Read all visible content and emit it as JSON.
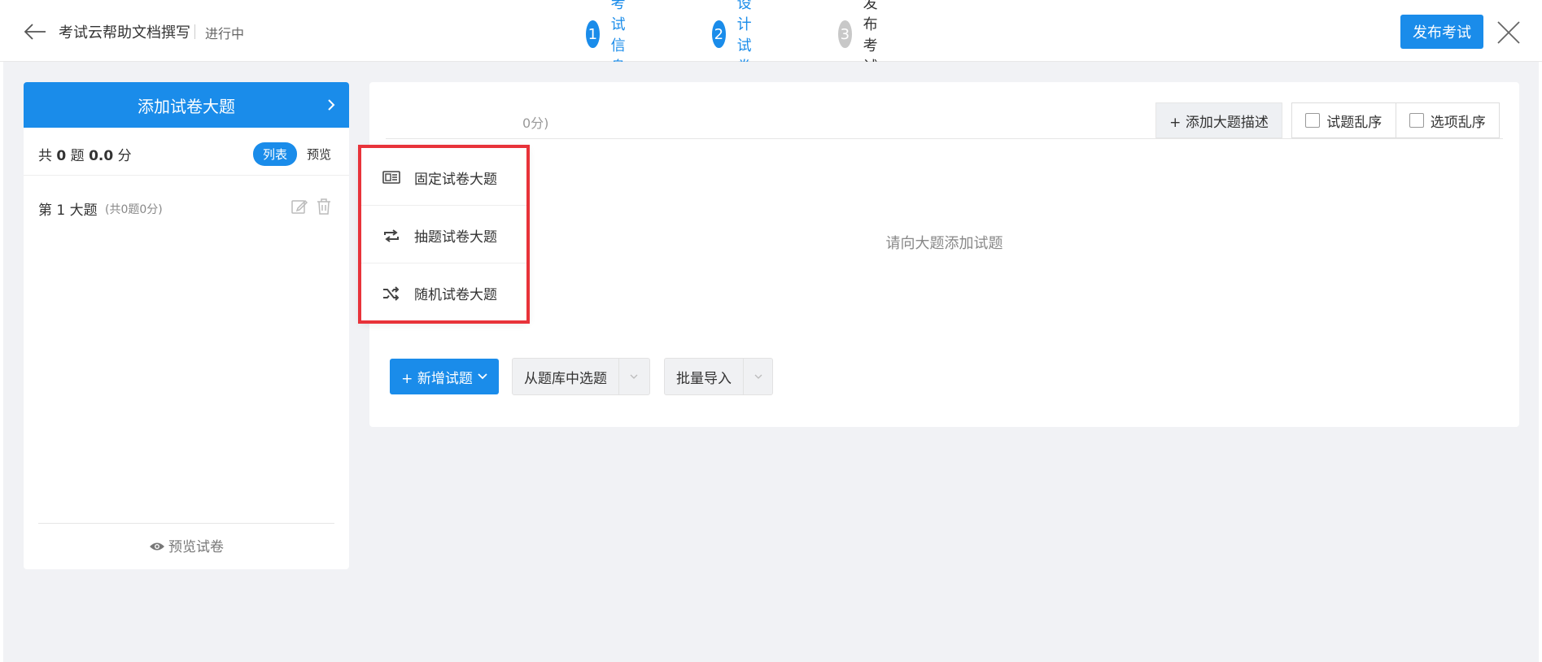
{
  "header": {
    "title": "考试云帮助文档撰写",
    "status": "进行中",
    "steps": [
      {
        "num": "1",
        "label": "考试信息"
      },
      {
        "num": "2",
        "label": "设计试卷"
      },
      {
        "num": "3",
        "label": "发布考试"
      }
    ],
    "publish_label": "发布考试"
  },
  "left": {
    "add_section_label": "添加试卷大题",
    "summary": {
      "prefix": "共",
      "count": "0",
      "mid": "题",
      "score": "0.0",
      "suffix": "分"
    },
    "view_list": "列表",
    "view_preview": "预览",
    "section": {
      "name": "第 1 大题",
      "meta": "(共0题0分)"
    },
    "preview_paper": "预览试卷"
  },
  "dropdown": {
    "items": [
      {
        "label": "固定试卷大题",
        "icon": "newspaper-icon"
      },
      {
        "label": "抽题试卷大题",
        "icon": "repeat-icon"
      },
      {
        "label": "随机试卷大题",
        "icon": "shuffle-icon"
      }
    ]
  },
  "right": {
    "title_fragment": "0分)",
    "add_desc_label": "+ 添加大题描述",
    "shuffle_questions": "试题乱序",
    "shuffle_options": "选项乱序",
    "empty_hint": "请向大题添加试题",
    "new_question_label": "+ 新增试题",
    "from_bank_label": "从题库中选题",
    "batch_import_label": "批量导入"
  },
  "colors": {
    "primary": "#1a8cea",
    "highlight": "#e8333a",
    "background": "#f1f2f5"
  }
}
